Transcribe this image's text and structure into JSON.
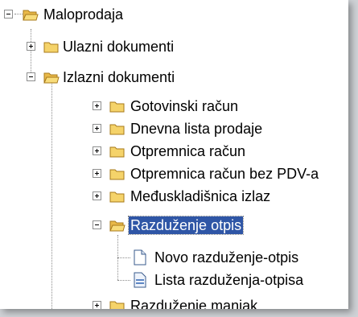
{
  "tree": {
    "root": {
      "label": "Maloprodaja",
      "icon": "folder-open-icon"
    },
    "ulazni": {
      "label": "Ulazni dokumenti",
      "icon": "folder-icon"
    },
    "izlazni": {
      "label": "Izlazni dokumenti",
      "icon": "folder-open-icon"
    },
    "children": [
      {
        "label": "Gotovinski račun"
      },
      {
        "label": "Dnevna lista prodaje"
      },
      {
        "label": "Otpremnica račun"
      },
      {
        "label": "Otpremnica račun bez PDV-a"
      },
      {
        "label": "Međuskladišnica izlaz"
      }
    ],
    "razduzenje": {
      "label": "Razduženje otpis",
      "items": [
        {
          "label": "Novo razduženje-otpis",
          "icon": "new-document-icon"
        },
        {
          "label": "Lista razduženja-otpisa",
          "icon": "document-list-icon"
        }
      ]
    },
    "manjak": {
      "label": "Razduženje manjak"
    }
  },
  "colors": {
    "selection": "#2f56a6",
    "folder": "#f5d36a",
    "background": "#ffffff"
  }
}
